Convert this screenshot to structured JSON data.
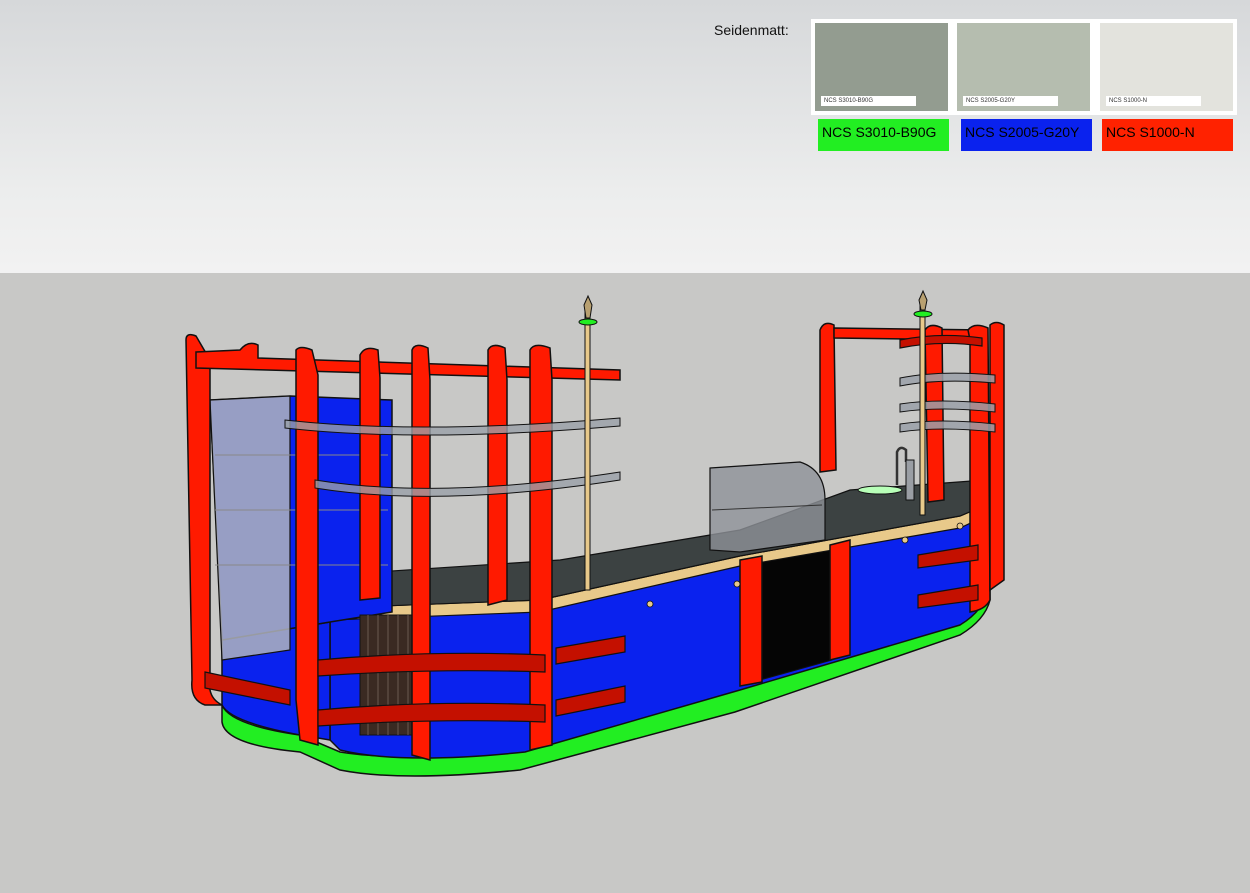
{
  "legend": {
    "title": "Seidenmatt:",
    "swatches": [
      {
        "name": "NCS S3010-B90G",
        "swatch_label": "NCS S3010-B90G",
        "swatch_color": "#939c90",
        "code_label": "NCS S3010-B90G",
        "code_color": "#22ee22"
      },
      {
        "name": "NCS S2005-G20Y",
        "swatch_label": "NCS S2005-G20Y",
        "swatch_color": "#b5bdaf",
        "code_label": "NCS S2005-G20Y",
        "code_color": "#0a22ee"
      },
      {
        "name": "NCS S1000-N",
        "swatch_label": "NCS S1000-N",
        "swatch_color": "#e3e3dd",
        "code_label": "NCS S1000-N",
        "code_color": "#ff2200"
      }
    ]
  },
  "colors": {
    "frame_red": "#ff1a00",
    "panel_blue": "#0a22ee",
    "base_green": "#22ee22",
    "countertop": "#3c4242",
    "wood_edge": "#e8c98a",
    "glass": "#b0b4bc"
  }
}
